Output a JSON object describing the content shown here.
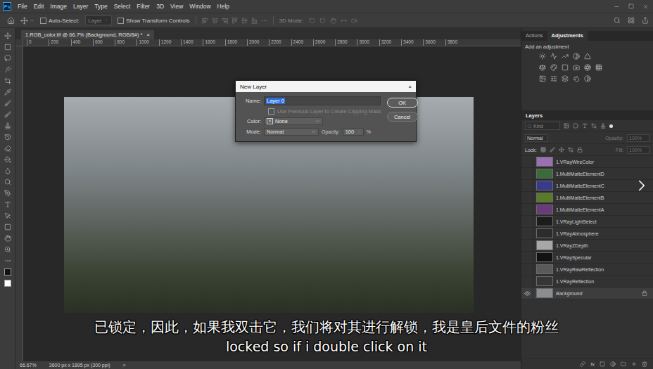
{
  "app": {
    "logo": "Ps"
  },
  "menu": [
    "File",
    "Edit",
    "Image",
    "Layer",
    "Type",
    "Select",
    "Filter",
    "3D",
    "View",
    "Window",
    "Help"
  ],
  "options_bar": {
    "auto_select_label": "Auto-Select:",
    "auto_select_checked": false,
    "auto_select_target": "Layer",
    "transform_label": "Show Transform Controls",
    "transform_checked": false,
    "mode_3d_label": "3D Mode:"
  },
  "document_tab": {
    "title": "1.RGB_color.tif @ 66.7% (Background, RGB/8#) *",
    "close": "×"
  },
  "ruler": {
    "ticks": [
      "0",
      "200",
      "400",
      "600",
      "800",
      "1000",
      "1200",
      "1400",
      "1600",
      "1800",
      "2000",
      "2200",
      "2400",
      "2600",
      "2800",
      "3000",
      "3200",
      "3400",
      "3600",
      "3800"
    ]
  },
  "dialog": {
    "title": "New Layer",
    "close": "×",
    "name_label": "Name:",
    "name_value": "Layer 0",
    "name_selected": true,
    "clip_label": "Use Previous Layer to Create Clipping Mask",
    "clip_checked": false,
    "clip_disabled": true,
    "color_label": "Color:",
    "color_mark": "X",
    "color_value": "None",
    "mode_label": "Mode:",
    "mode_value": "Normal",
    "opacity_label": "Opacity:",
    "opacity_value": "100",
    "opacity_unit": "%",
    "buttons": [
      {
        "label": "OK",
        "default": true
      },
      {
        "label": "Cancel",
        "default": false
      }
    ]
  },
  "subtitles": [
    "已锁定，因此，如果我双击它，我们将对其进行解锁，我是皇后文件的粉丝",
    "locked so if i double click on it"
  ],
  "panel_tabs": [
    {
      "label": "Actions",
      "selected": false
    },
    {
      "label": "Adjustments",
      "selected": true
    }
  ],
  "adjustments": {
    "hint": "Add an adjustment"
  },
  "layers_panel": {
    "title": "Layers",
    "filter_placeholder": "Kind",
    "blend_mode": "Normal",
    "opacity_label": "Opacity:",
    "opacity_value": "100%",
    "opacity_disabled": true,
    "lock_label": "Lock:",
    "fill_label": "Fill:",
    "fill_value": "100%",
    "fill_disabled": true,
    "footer_fx": "fx",
    "layers": [
      {
        "name": "1.VRayWireColor",
        "kind": "layer",
        "visible": false,
        "selected": false,
        "locked": false,
        "color": "#9a70b0"
      },
      {
        "name": "1.MultiMatteElementD",
        "kind": "layer",
        "visible": false,
        "selected": false,
        "locked": false,
        "color": "#3d6a3a"
      },
      {
        "name": "1.MultiMatteElementC",
        "kind": "layer",
        "visible": false,
        "selected": false,
        "locked": false,
        "color": "#3a3a8a"
      },
      {
        "name": "1.MultiMatteElementB",
        "kind": "layer",
        "visible": false,
        "selected": false,
        "locked": false,
        "color": "#5a7a2a"
      },
      {
        "name": "1.MultiMatteElementA",
        "kind": "layer",
        "visible": false,
        "selected": false,
        "locked": false,
        "color": "#6a3a7a"
      },
      {
        "name": "1.VRayLightSelect",
        "kind": "layer",
        "visible": false,
        "selected": false,
        "locked": false,
        "color": "#1c1c1c"
      },
      {
        "name": "1.VRayAtmosphere",
        "kind": "layer",
        "visible": false,
        "selected": false,
        "locked": false,
        "color": "#2c2c2c"
      },
      {
        "name": "1.VRayZDepth",
        "kind": "layer",
        "visible": false,
        "selected": false,
        "locked": false,
        "color": "#a8a8a8"
      },
      {
        "name": "1.VRaySpecular",
        "kind": "layer",
        "visible": false,
        "selected": false,
        "locked": false,
        "color": "#121212"
      },
      {
        "name": "1.VRayRawReflection",
        "kind": "layer",
        "visible": false,
        "selected": false,
        "locked": false,
        "color": "#5a5a5a"
      },
      {
        "name": "1.VRayReflection",
        "kind": "layer",
        "visible": false,
        "selected": false,
        "locked": false,
        "color": "#363636"
      },
      {
        "name": "Background",
        "kind": "background",
        "visible": true,
        "selected": true,
        "locked": true,
        "color": "#8a8e90"
      }
    ]
  },
  "status_bar": {
    "zoom": "66.67%",
    "size": "3600 px x 1895 px (300 ppi)",
    "arrow": ">"
  }
}
